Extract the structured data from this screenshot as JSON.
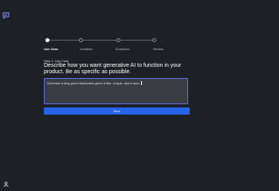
{
  "sidebar": {
    "logo_icon": "chat-bubble-logo-icon",
    "user_icon": "user-icon"
  },
  "stepper": {
    "steps": [
      {
        "label": "Use Case",
        "active": true
      },
      {
        "label": "Variables",
        "active": false
      },
      {
        "label": "Examples",
        "active": false
      },
      {
        "label": "Review",
        "active": false
      }
    ]
  },
  "main": {
    "step_eyebrow": "Step 1: Use Case",
    "heading": "Describe how you want generative AI to function in your product. Be as specific as possible.",
    "use_case_value": "Generate a blog post introduction given a title, a topic, and a tone.",
    "next_label": "Next"
  },
  "colors": {
    "background": "#1d2024",
    "accent": "#2563eb",
    "logo": "#7b8cff"
  }
}
